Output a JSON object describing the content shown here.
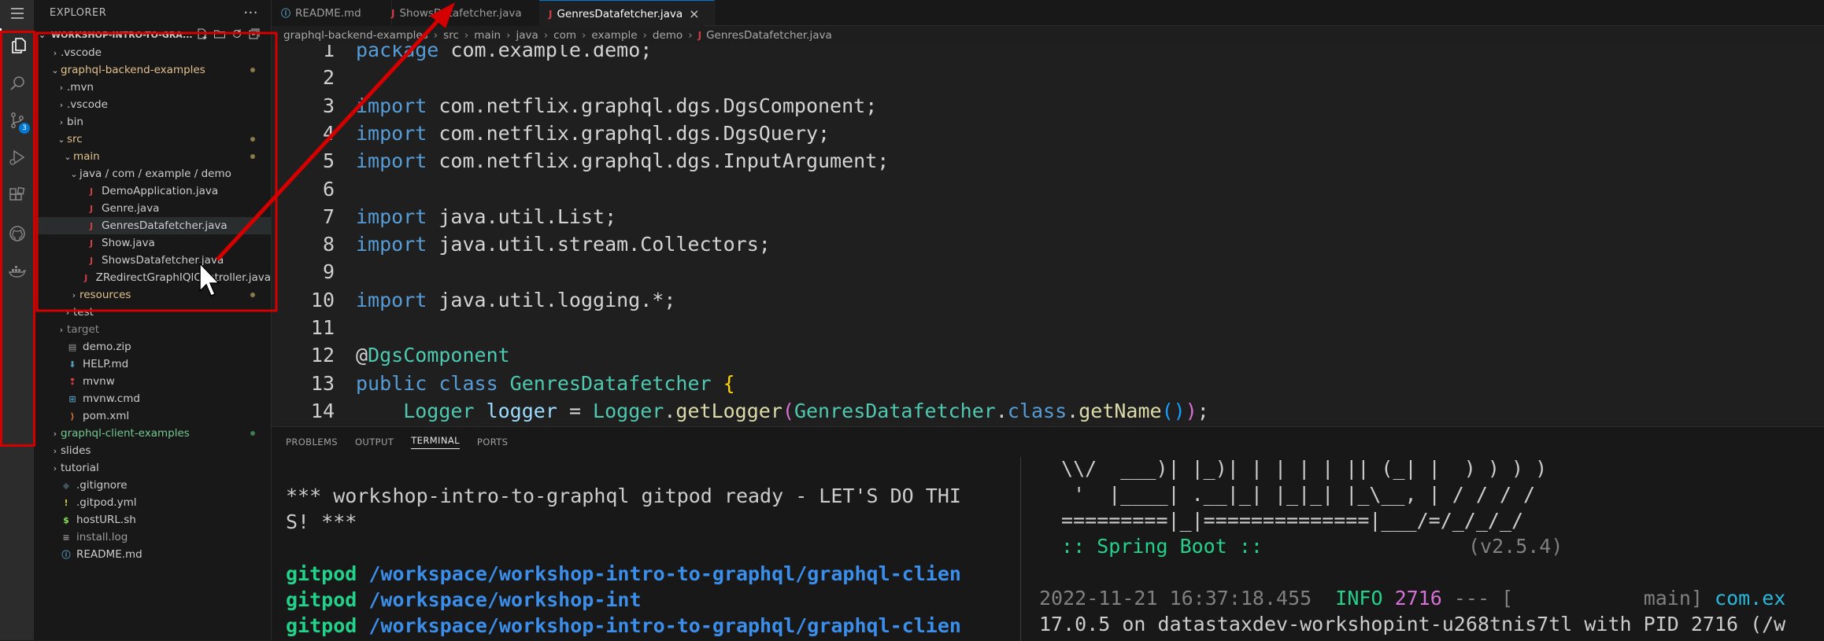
{
  "explorer": {
    "title": "EXPLORER",
    "more": "···",
    "workspace": "WORKSHOP-INTRO-TO-GRA...",
    "tree": [
      {
        "label": ".vscode",
        "chev": "›",
        "color": "#cccccc",
        "icon": "",
        "dot": ""
      },
      {
        "label": "graphql-backend-examples",
        "chev": "⌄",
        "color": "#e2c08d",
        "icon": "",
        "dot": "#8a7a4a"
      },
      {
        "label": ".mvn",
        "chev": "›",
        "color": "#cccccc",
        "icon": "",
        "dot": ""
      },
      {
        "label": ".vscode",
        "chev": "›",
        "color": "#cccccc",
        "icon": "",
        "dot": ""
      },
      {
        "label": "bin",
        "chev": "›",
        "color": "#cccccc",
        "icon": "",
        "dot": ""
      },
      {
        "label": "src",
        "chev": "⌄",
        "color": "#e2c08d",
        "icon": "",
        "dot": "#8a7a4a"
      },
      {
        "label": "main",
        "chev": "⌄",
        "color": "#e2c08d",
        "icon": "",
        "dot": "#8a7a4a"
      },
      {
        "label": "java / com / example / demo",
        "chev": "⌄",
        "color": "#cccccc",
        "icon": "",
        "dot": ""
      },
      {
        "label": "DemoApplication.java",
        "chev": "",
        "color": "#cccccc",
        "icon": "J",
        "dot": ""
      },
      {
        "label": "Genre.java",
        "chev": "",
        "color": "#cccccc",
        "icon": "J",
        "dot": ""
      },
      {
        "label": "GenresDatafetcher.java",
        "chev": "",
        "color": "#cccccc",
        "icon": "J",
        "dot": ""
      },
      {
        "label": "Show.java",
        "chev": "",
        "color": "#cccccc",
        "icon": "J",
        "dot": ""
      },
      {
        "label": "ShowsDatafetcher.java",
        "chev": "",
        "color": "#cccccc",
        "icon": "J",
        "dot": ""
      },
      {
        "label": "ZRedirectGraphIQlController.java",
        "chev": "",
        "color": "#cccccc",
        "icon": "J",
        "dot": ""
      },
      {
        "label": "resources",
        "chev": "›",
        "color": "#e2c08d",
        "icon": "",
        "dot": "#8a7a4a"
      },
      {
        "label": "test",
        "chev": "›",
        "color": "#cccccc",
        "icon": "",
        "dot": ""
      },
      {
        "label": "target",
        "chev": "›",
        "color": "#8c8c8c",
        "icon": "",
        "dot": ""
      },
      {
        "label": "demo.zip",
        "chev": "",
        "color": "#cccccc",
        "icon": "▤",
        "dot": ""
      },
      {
        "label": "HELP.md",
        "chev": "",
        "color": "#cccccc",
        "icon": "⬇",
        "dot": ""
      },
      {
        "label": "mvnw",
        "chev": "",
        "color": "#cccccc",
        "icon": "❢",
        "dot": ""
      },
      {
        "label": "mvnw.cmd",
        "chev": "",
        "color": "#cccccc",
        "icon": "⊞",
        "dot": ""
      },
      {
        "label": "pom.xml",
        "chev": "",
        "color": "#cccccc",
        "icon": "⟩",
        "dot": ""
      },
      {
        "label": "graphql-client-examples",
        "chev": "›",
        "color": "#73c991",
        "icon": "",
        "dot": "#3f7a52"
      },
      {
        "label": "slides",
        "chev": "›",
        "color": "#cccccc",
        "icon": "",
        "dot": ""
      },
      {
        "label": "tutorial",
        "chev": "›",
        "color": "#cccccc",
        "icon": "",
        "dot": ""
      },
      {
        "label": ".gitignore",
        "chev": "",
        "color": "#cccccc",
        "icon": "◆",
        "dot": ""
      },
      {
        "label": ".gitpod.yml",
        "chev": "",
        "color": "#cccccc",
        "icon": "!",
        "dot": ""
      },
      {
        "label": "hostURL.sh",
        "chev": "",
        "color": "#cccccc",
        "icon": "$",
        "dot": ""
      },
      {
        "label": "install.log",
        "chev": "",
        "color": "#9d9d9d",
        "icon": "≡",
        "dot": ""
      },
      {
        "label": "README.md",
        "chev": "",
        "color": "#cccccc",
        "icon": "ⓘ",
        "dot": ""
      }
    ]
  },
  "tabs": [
    {
      "label": "README.md",
      "icon": "ⓘ",
      "icon_color": "#519aba",
      "active": false
    },
    {
      "label": "ShowsDatafetcher.java",
      "icon": "J",
      "icon_color": "#cc3e44",
      "active": false
    },
    {
      "label": "GenresDatafetcher.java",
      "icon": "J",
      "icon_color": "#cc3e44",
      "active": true,
      "close": "×"
    }
  ],
  "breadcrumb": [
    "graphql-backend-examples",
    "src",
    "main",
    "java",
    "com",
    "example",
    "demo",
    "GenresDatafetcher.java"
  ],
  "editor": {
    "lines": [
      {
        "n": "1",
        "tokens": [
          {
            "t": "package ",
            "c": "#569cd6"
          },
          {
            "t": "com.example.demo;",
            "c": "#d4d4d4"
          }
        ]
      },
      {
        "n": "2",
        "tokens": []
      },
      {
        "n": "3",
        "tokens": [
          {
            "t": "import ",
            "c": "#569cd6"
          },
          {
            "t": "com.netflix.graphql.dgs.DgsComponent;",
            "c": "#d4d4d4"
          }
        ]
      },
      {
        "n": "4",
        "tokens": [
          {
            "t": "import ",
            "c": "#569cd6"
          },
          {
            "t": "com.netflix.graphql.dgs.DgsQuery;",
            "c": "#d4d4d4"
          }
        ]
      },
      {
        "n": "5",
        "tokens": [
          {
            "t": "import ",
            "c": "#569cd6"
          },
          {
            "t": "com.netflix.graphql.dgs.InputArgument;",
            "c": "#d4d4d4"
          }
        ]
      },
      {
        "n": "6",
        "tokens": []
      },
      {
        "n": "7",
        "tokens": [
          {
            "t": "import ",
            "c": "#569cd6"
          },
          {
            "t": "java.util.List;",
            "c": "#d4d4d4"
          }
        ]
      },
      {
        "n": "8",
        "tokens": [
          {
            "t": "import ",
            "c": "#569cd6"
          },
          {
            "t": "java.util.stream.Collectors;",
            "c": "#d4d4d4"
          }
        ]
      },
      {
        "n": "9",
        "tokens": []
      },
      {
        "n": "10",
        "tokens": [
          {
            "t": "import ",
            "c": "#569cd6"
          },
          {
            "t": "java.util.logging.*;",
            "c": "#d4d4d4"
          }
        ]
      },
      {
        "n": "11",
        "tokens": []
      },
      {
        "n": "12",
        "tokens": [
          {
            "t": "@",
            "c": "#d4d4d4"
          },
          {
            "t": "DgsComponent",
            "c": "#4ec9b0"
          }
        ]
      },
      {
        "n": "13",
        "tokens": [
          {
            "t": "public ",
            "c": "#569cd6"
          },
          {
            "t": "class ",
            "c": "#569cd6"
          },
          {
            "t": "GenresDatafetcher ",
            "c": "#4ec9b0"
          },
          {
            "t": "{",
            "c": "#ffd700"
          }
        ]
      },
      {
        "n": "14",
        "tokens": [
          {
            "t": "    Logger ",
            "c": "#4ec9b0"
          },
          {
            "t": "logger ",
            "c": "#9cdcfe"
          },
          {
            "t": "= ",
            "c": "#d4d4d4"
          },
          {
            "t": "Logger",
            "c": "#4ec9b0"
          },
          {
            "t": ".",
            "c": "#d4d4d4"
          },
          {
            "t": "getLogger",
            "c": "#dcdcaa"
          },
          {
            "t": "(",
            "c": "#da70d6"
          },
          {
            "t": "GenresDatafetcher",
            "c": "#4ec9b0"
          },
          {
            "t": ".",
            "c": "#d4d4d4"
          },
          {
            "t": "class",
            "c": "#569cd6"
          },
          {
            "t": ".",
            "c": "#d4d4d4"
          },
          {
            "t": "getName",
            "c": "#dcdcaa"
          },
          {
            "t": "()",
            "c": "#179fff"
          },
          {
            "t": ")",
            "c": "#da70d6"
          },
          {
            "t": ";",
            "c": "#d4d4d4"
          }
        ]
      }
    ]
  },
  "panel": {
    "tabs": [
      "PROBLEMS",
      "OUTPUT",
      "TERMINAL",
      "PORTS"
    ],
    "active_tab": "TERMINAL",
    "terminal_left": [
      {
        "text": "*** workshop-intro-to-graphql gitpod ready - LET'S DO THI",
        "prompt": "",
        "path": ""
      },
      {
        "text": "S! ***",
        "prompt": "",
        "path": ""
      },
      {
        "text": "",
        "prompt": "",
        "path": ""
      },
      {
        "text": "",
        "prompt": "gitpod ",
        "path": "/workspace/workshop-intro-to-graphql/graphql-clien"
      },
      {
        "text": "",
        "prompt": "gitpod ",
        "path": "/workspace/workshop-int"
      },
      {
        "text": "",
        "prompt": "gitpod ",
        "path": "/workspace/workshop-intro-to-graphql/graphql-clien"
      }
    ],
    "terminal_right": {
      "banner": [
        " \\\\/  ___)| |_)| | | | | || (_| |  ) ) ) )",
        "  '  |____| .__|_| |_|_| |_\\__, | / / / /",
        " =========|_|==============|___/=/_/_/_/"
      ],
      "spring_label": " :: Spring Boot ::",
      "spring_version": "(v2.5.4)",
      "log_time": "2022-11-21 16:37:18.455",
      "log_level": "INFO",
      "log_pid": "2716",
      "log_rest": "--- [",
      "log_thread": "main]",
      "log_class": "com.ex",
      "log_line2": "17.0.5 on datastaxdev-workshopint-u268tnis7tl with PID 2716 (/w"
    }
  },
  "activity_badge": "3",
  "colors": {
    "accent": "#0078d4",
    "annotation": "#d40000",
    "prompt": "#23d18b",
    "path": "#3b8eea"
  }
}
